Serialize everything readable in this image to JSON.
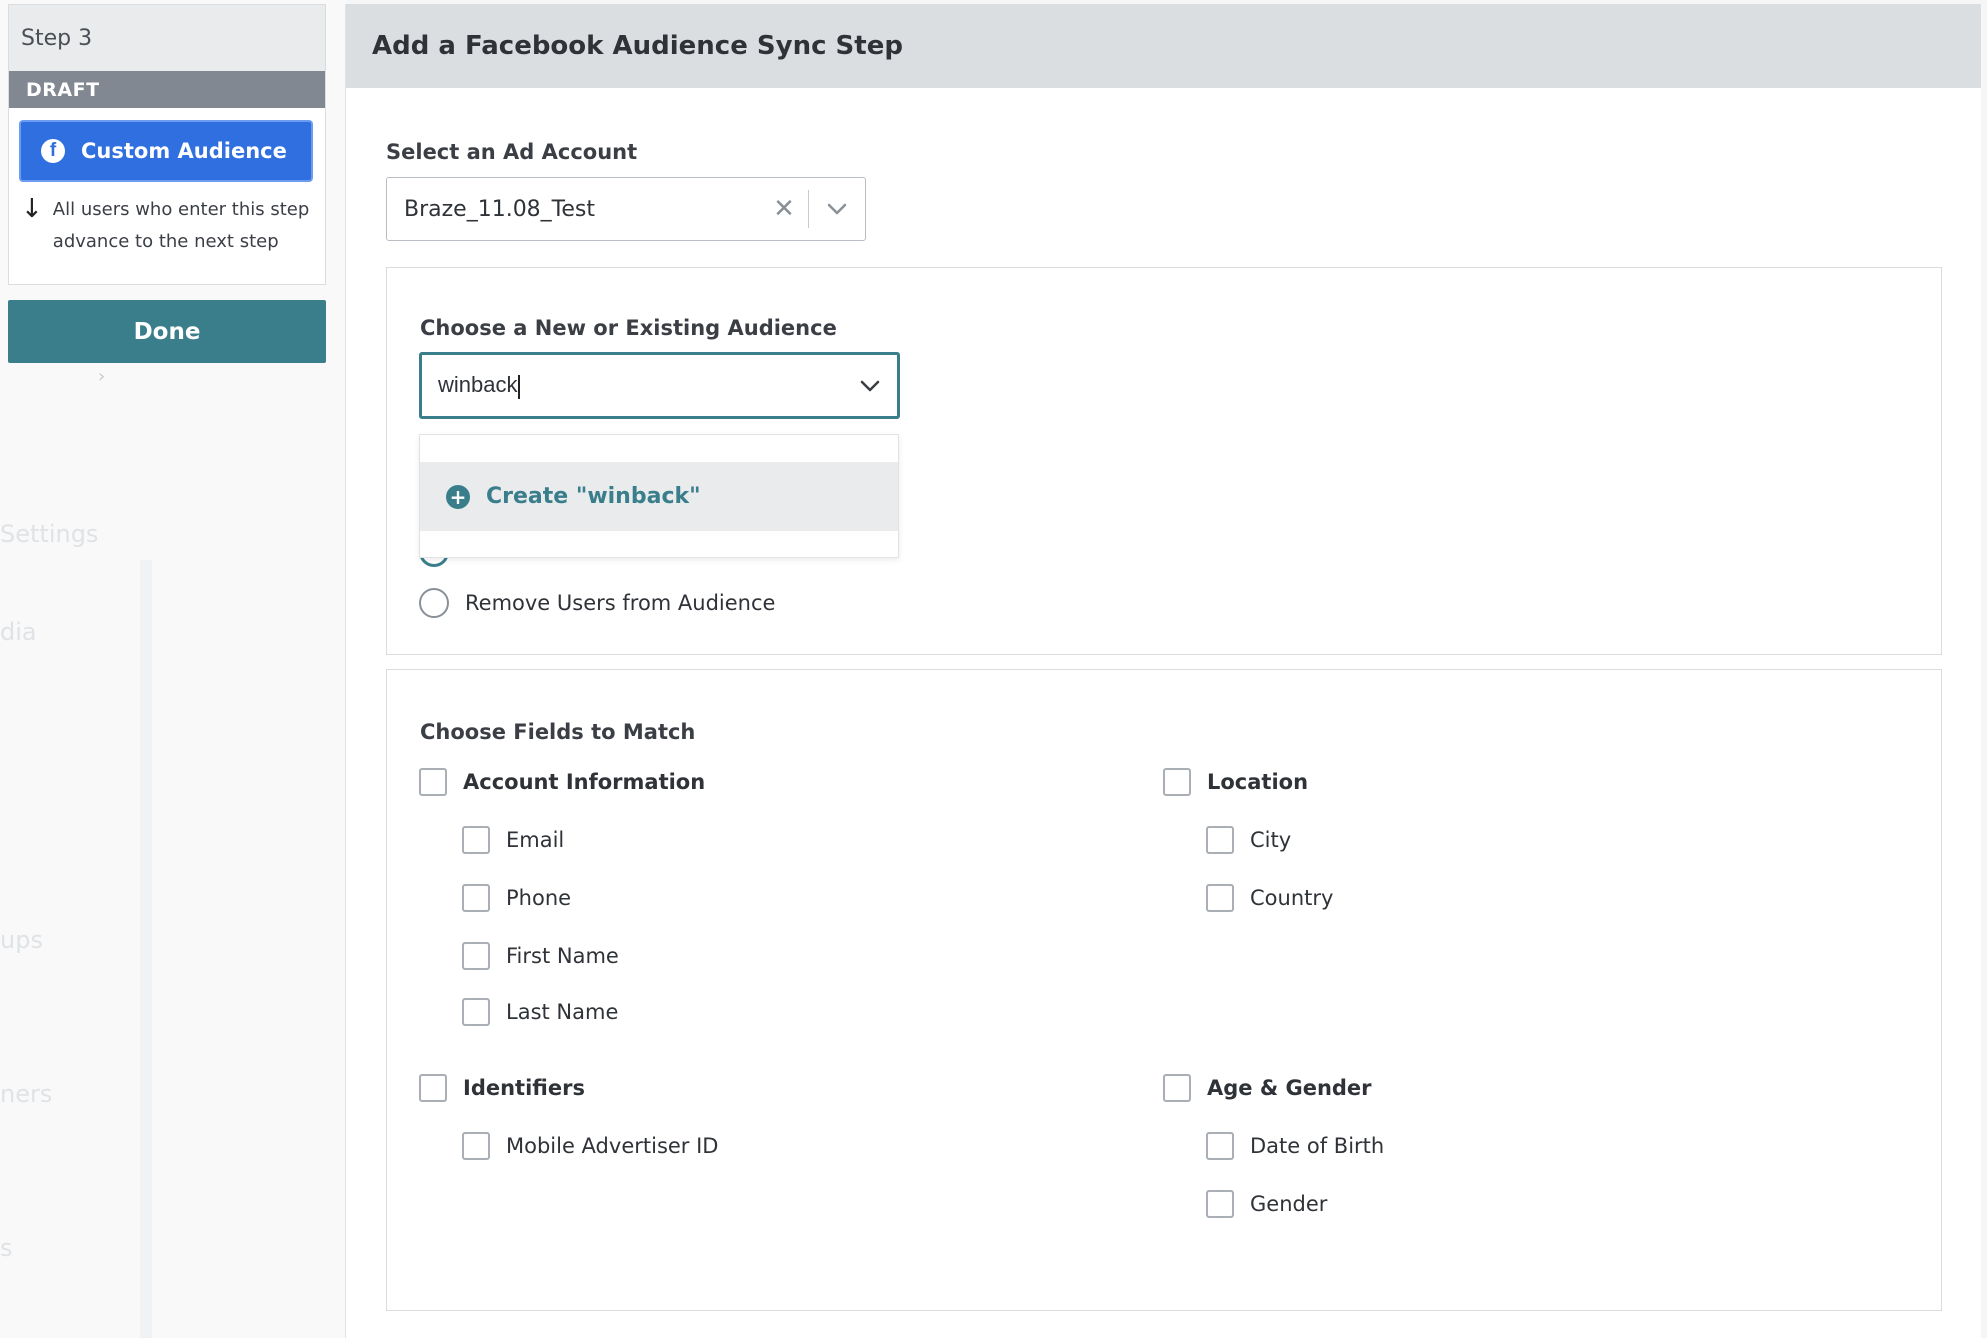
{
  "sidebar": {
    "step_title": "Step 3",
    "status_badge": "DRAFT",
    "step_button_label": "Custom Audience",
    "advance_text_line1": "All users who enter this step",
    "advance_text_line2": "advance to the next step",
    "done_label": "Done",
    "ghost_labels": [
      "Settings",
      "dia",
      "ups",
      "ners",
      "s"
    ]
  },
  "modal": {
    "title": "Add a Facebook Audience Sync Step",
    "ad_account": {
      "label": "Select an Ad Account",
      "value": "Braze_11.08_Test"
    },
    "audience": {
      "label": "Choose a New or Existing Audience",
      "input_value": "winback",
      "dropdown_option": "Create \"winback\"",
      "remove_option_label": "Remove Users from Audience"
    },
    "fields": {
      "label": "Choose Fields to Match",
      "groups": [
        {
          "title": "Account Information",
          "items": [
            "Email",
            "Phone",
            "First Name",
            "Last Name"
          ]
        },
        {
          "title": "Location",
          "items": [
            "City",
            "Country"
          ]
        },
        {
          "title": "Identifiers",
          "items": [
            "Mobile Advertiser ID"
          ]
        },
        {
          "title": "Age & Gender",
          "items": [
            "Date of Birth",
            "Gender"
          ]
        }
      ]
    }
  },
  "colors": {
    "accent_teal": "#3a7e8c",
    "facebook_blue": "#2f6fe0",
    "draft_gray": "#818891",
    "header_gray": "#dadee1"
  }
}
